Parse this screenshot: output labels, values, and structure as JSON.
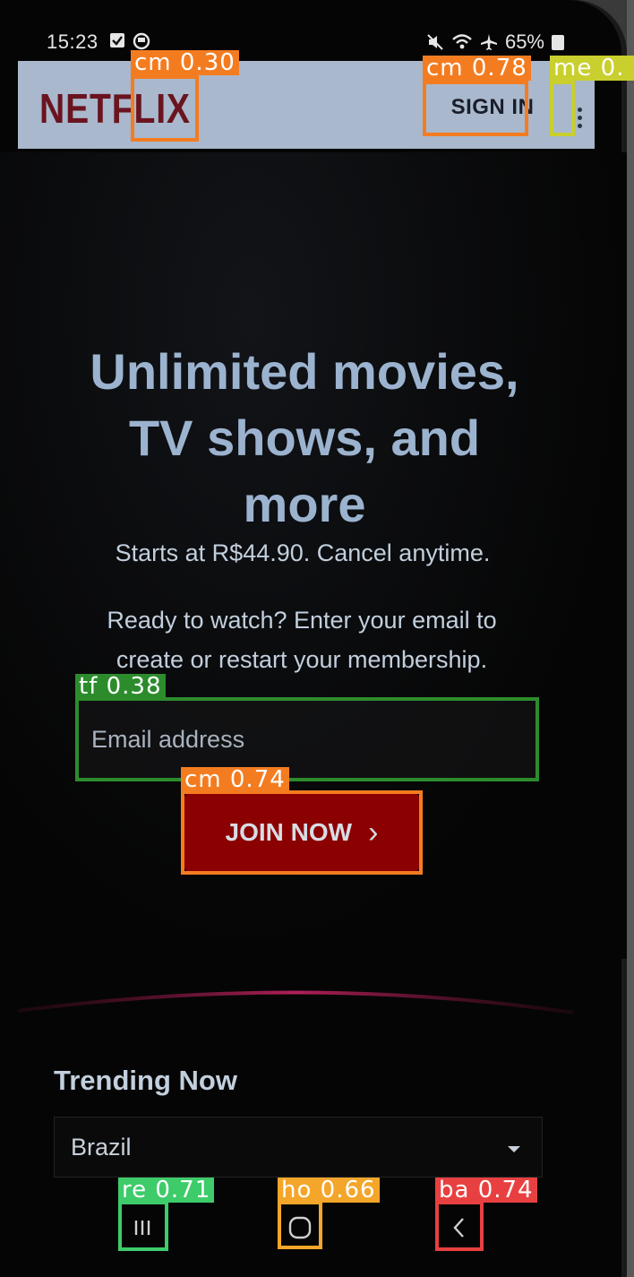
{
  "status_bar": {
    "time": "15:23",
    "battery": "65%"
  },
  "header": {
    "logo": "NETFLIX",
    "sign_in": "SIGN IN"
  },
  "hero": {
    "title_line1": "Unlimited movies,",
    "title_line2": "TV shows, and",
    "title_line3": "more",
    "subtitle": "Starts at R$44.90. Cancel anytime.",
    "prompt_line1": "Ready to watch? Enter your email to",
    "prompt_line2": "create or restart your membership.",
    "email_placeholder": "Email address",
    "join_label": "JOIN NOW",
    "join_chevron": "›"
  },
  "trending": {
    "title": "Trending Now",
    "region": "Brazil"
  },
  "detections": [
    {
      "tag": "cm 0.30",
      "color": "#f47c20"
    },
    {
      "tag": "cm 0.78",
      "color": "#f47c20"
    },
    {
      "tag": "me 0.",
      "color": "#c9cf2e"
    },
    {
      "tag": "tf 0.38",
      "color": "#2c8c2c"
    },
    {
      "tag": "cm 0.74",
      "color": "#f47c20"
    },
    {
      "tag": "re 0.71",
      "color": "#3ecb6a"
    },
    {
      "tag": "ho 0.66",
      "color": "#f4a62a"
    },
    {
      "tag": "ba 0.74",
      "color": "#e84040"
    }
  ]
}
